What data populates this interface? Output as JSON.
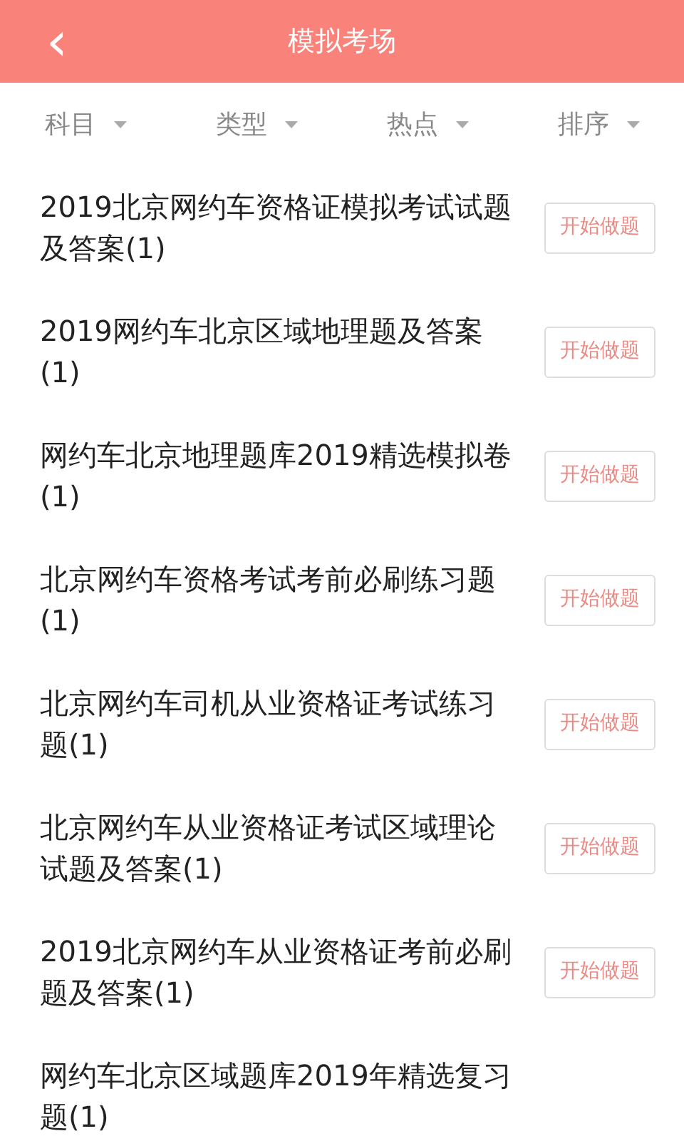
{
  "header": {
    "back_icon": "‹",
    "title": "模拟考场"
  },
  "filters": [
    {
      "label": "科目"
    },
    {
      "label": "类型"
    },
    {
      "label": "热点"
    },
    {
      "label": "排序"
    }
  ],
  "exams": [
    {
      "title": "2019北京网约车资格证模拟考试试题及答案(1)",
      "button": "开始做题"
    },
    {
      "title": "2019网约车北京区域地理题及答案(1)",
      "button": "开始做题"
    },
    {
      "title": "网约车北京地理题库2019精选模拟卷(1)",
      "button": "开始做题"
    },
    {
      "title": "北京网约车资格考试考前必刷练习题(1)",
      "button": "开始做题"
    },
    {
      "title": "北京网约车司机从业资格证考试练习题(1)",
      "button": "开始做题"
    },
    {
      "title": "北京网约车从业资格证考试区域理论试题及答案(1)",
      "button": "开始做题"
    },
    {
      "title": "2019北京网约车从业资格证考前必刷题及答案(1)",
      "button": "开始做题"
    },
    {
      "title": "网约车北京区域题库2019年精选复习题(1)"
    }
  ]
}
